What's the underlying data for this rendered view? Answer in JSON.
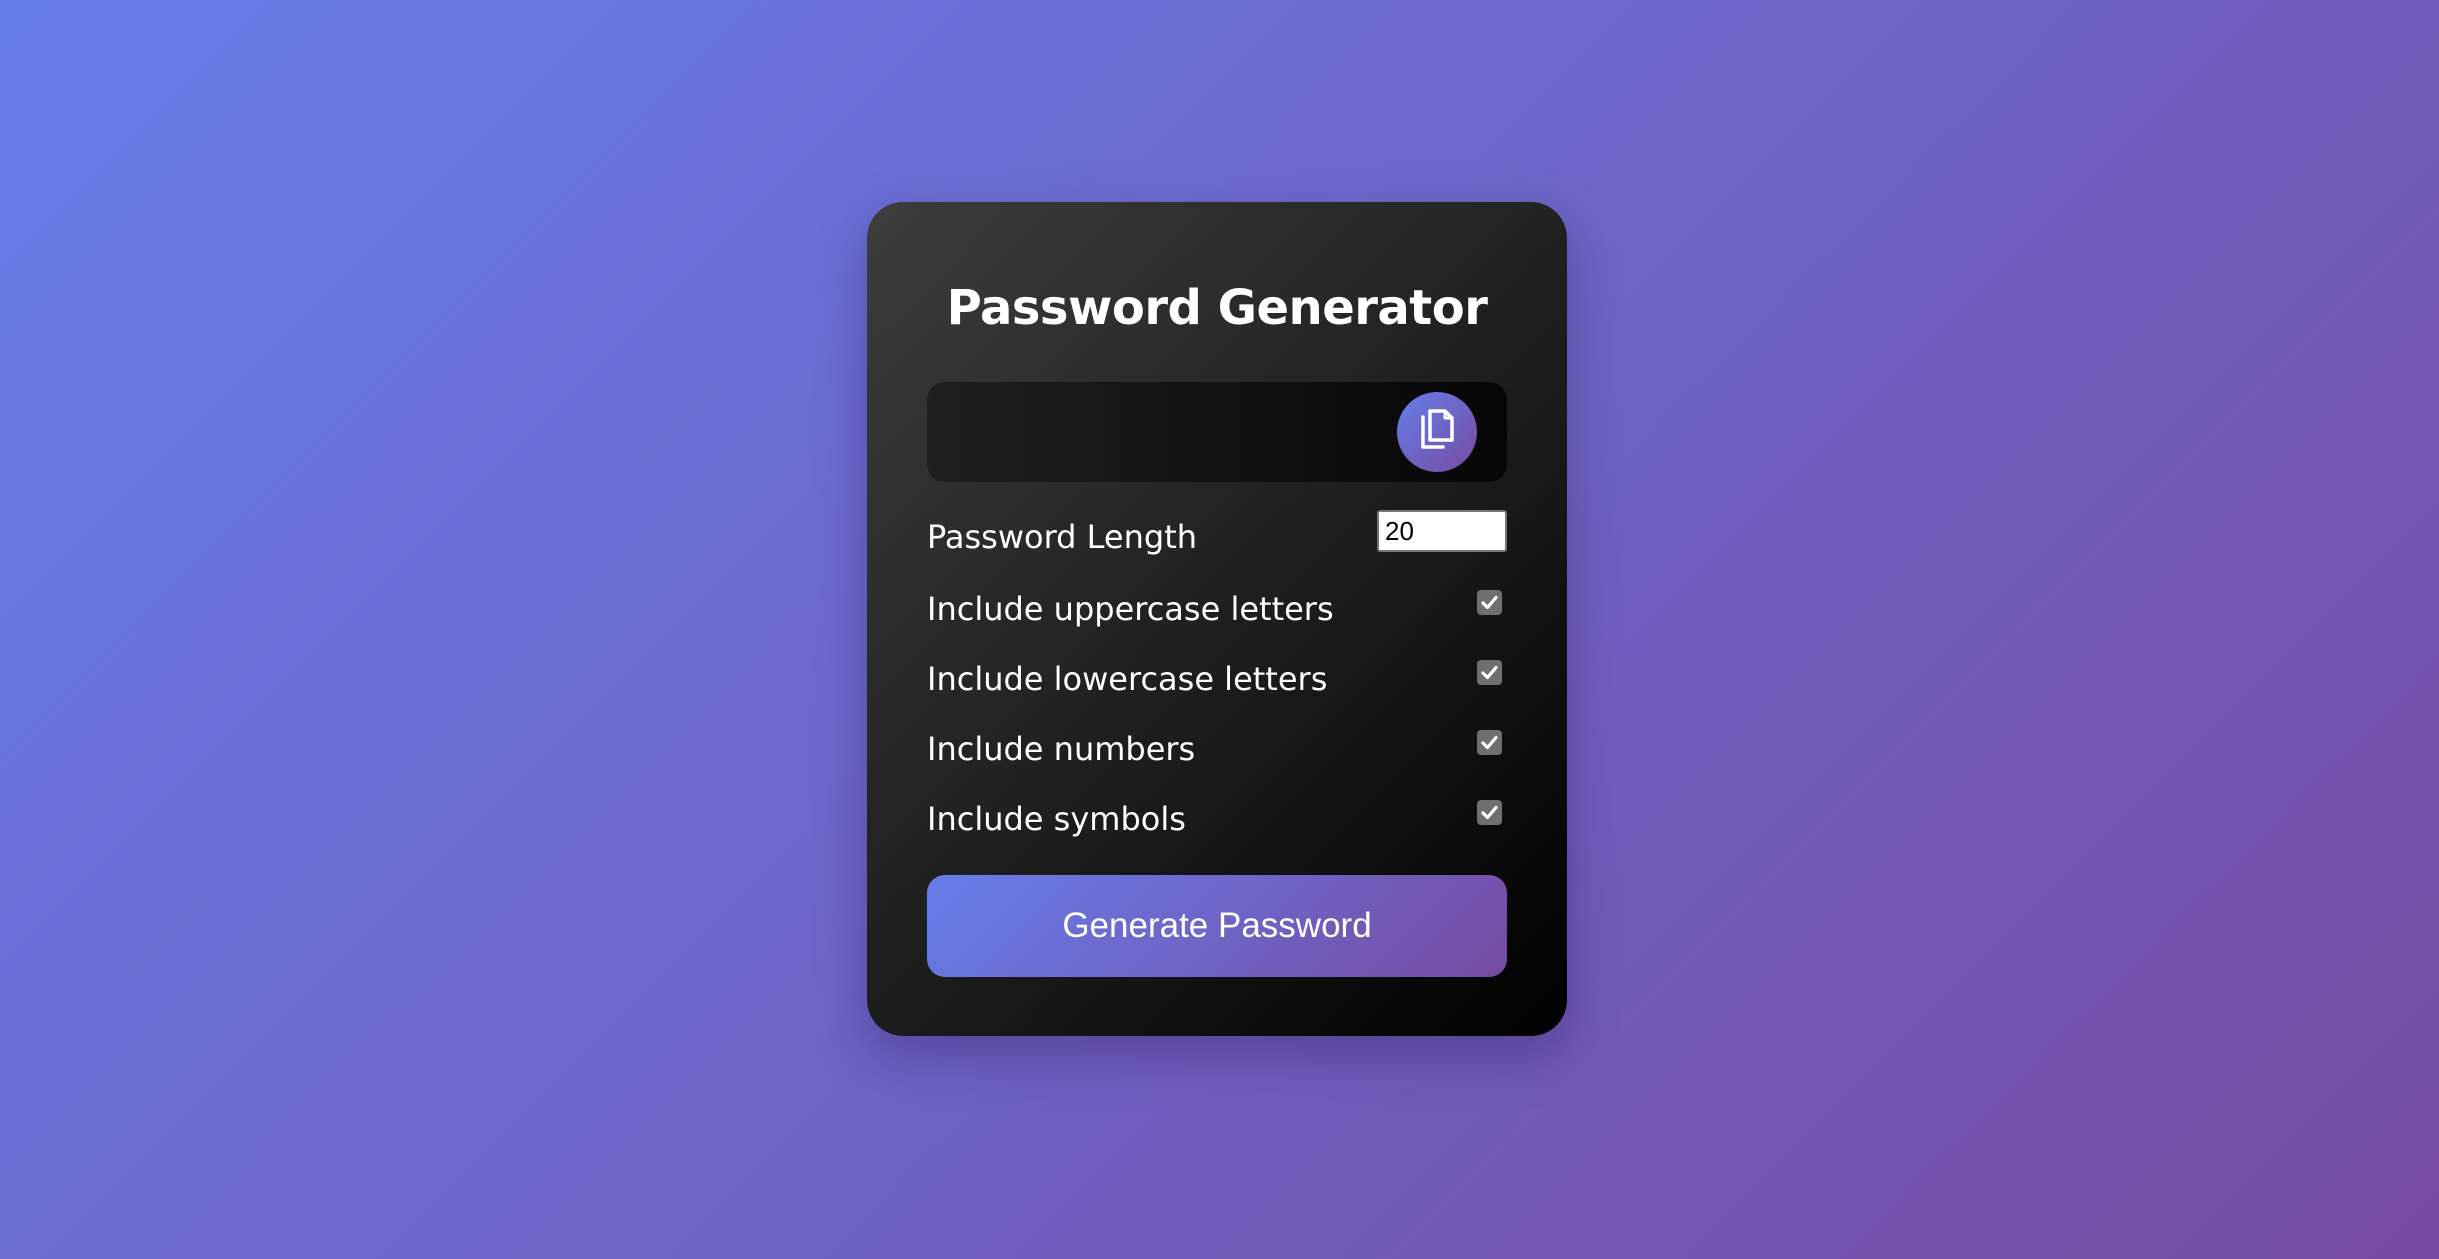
{
  "app": {
    "title": "Password Generator"
  },
  "result": {
    "password": "",
    "copy_icon": "copy-icon"
  },
  "settings": {
    "length_label": "Password Length",
    "length_value": "20",
    "options": [
      {
        "label": "Include uppercase letters",
        "checked": true
      },
      {
        "label": "Include lowercase letters",
        "checked": true
      },
      {
        "label": "Include numbers",
        "checked": true
      },
      {
        "label": "Include symbols",
        "checked": true
      }
    ]
  },
  "generate": {
    "label": "Generate Password"
  },
  "colors": {
    "gradient_start": "#667eea",
    "gradient_end": "#764ba2",
    "card_dark": "#000000",
    "text": "#ffffff"
  }
}
